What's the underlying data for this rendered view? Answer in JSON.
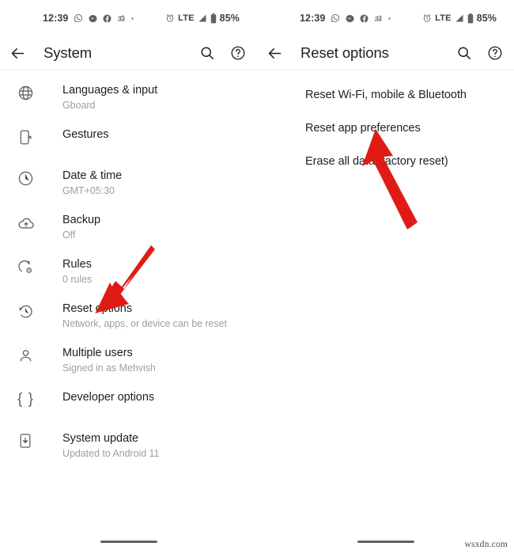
{
  "meta": {
    "watermark": "wsxdn.com",
    "accent_red": "#e01b16",
    "text_primary": "#202124",
    "text_secondary": "#9aa0a6",
    "icon_color": "#5f6368"
  },
  "left_screen": {
    "statusbar": {
      "time": "12:39",
      "lte_label": "LTE",
      "battery_percent": "85%",
      "left_icons": [
        "whatsapp-icon",
        "messenger-icon",
        "facebook-icon",
        "app-icon",
        "dot-icon"
      ],
      "right_icons": [
        "alarm-icon",
        "signal-icon",
        "battery-icon"
      ]
    },
    "appbar": {
      "back_icon": "back-arrow-icon",
      "title": "System",
      "search_icon": "search-icon",
      "help_icon": "help-icon"
    },
    "items": [
      {
        "icon": "globe-icon",
        "title": "Languages & input",
        "subtitle": "Gboard"
      },
      {
        "icon": "gestures-icon",
        "title": "Gestures",
        "subtitle": ""
      },
      {
        "icon": "clock-icon",
        "title": "Date & time",
        "subtitle": "GMT+05:30"
      },
      {
        "icon": "cloud-upload-icon",
        "title": "Backup",
        "subtitle": "Off"
      },
      {
        "icon": "rules-icon",
        "title": "Rules",
        "subtitle": "0 rules"
      },
      {
        "icon": "history-reset-icon",
        "title": "Reset options",
        "subtitle": "Network, apps, or device can be reset"
      },
      {
        "icon": "person-icon",
        "title": "Multiple users",
        "subtitle": "Signed in as Mehvish"
      },
      {
        "icon": "braces-icon",
        "title": "Developer options",
        "subtitle": ""
      },
      {
        "icon": "system-update-icon",
        "title": "System update",
        "subtitle": "Updated to Android 11"
      }
    ]
  },
  "right_screen": {
    "statusbar": {
      "time": "12:39",
      "lte_label": "LTE",
      "battery_percent": "85%"
    },
    "appbar": {
      "back_icon": "back-arrow-icon",
      "title": "Reset options",
      "search_icon": "search-icon",
      "help_icon": "help-icon"
    },
    "items": [
      {
        "title": "Reset Wi-Fi, mobile & Bluetooth"
      },
      {
        "title": "Reset app preferences"
      },
      {
        "title": "Erase all data (factory reset)"
      }
    ]
  },
  "annotations": [
    {
      "name": "arrow-to-reset-options",
      "color": "#e01b16"
    },
    {
      "name": "arrow-to-reset-app-preferences",
      "color": "#e01b16"
    }
  ]
}
